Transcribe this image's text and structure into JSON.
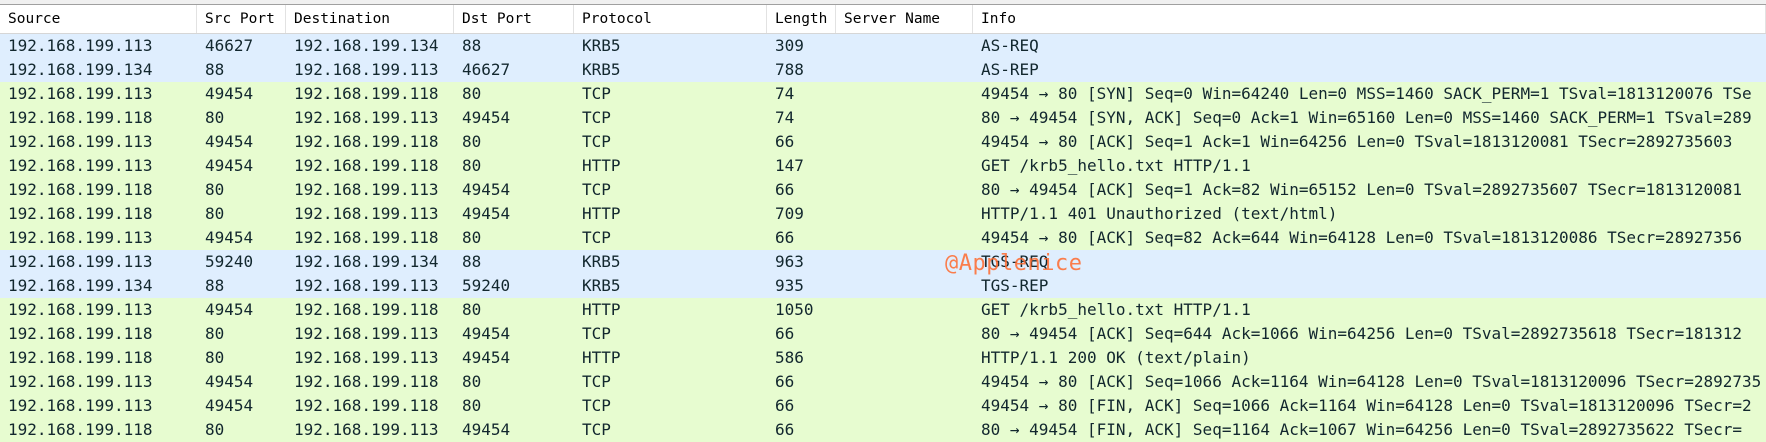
{
  "columns": {
    "source": "Source",
    "src_port": "Src Port",
    "destination": "Destination",
    "dst_port": "Dst Port",
    "protocol": "Protocol",
    "length": "Length",
    "server_name": "Server Name",
    "info": "Info"
  },
  "rows": [
    {
      "source": "192.168.199.113",
      "src_port": "46627",
      "destination": "192.168.199.134",
      "dst_port": "88",
      "protocol": "KRB5",
      "length": "309",
      "server_name": "",
      "info": "AS-REQ"
    },
    {
      "source": "192.168.199.134",
      "src_port": "88",
      "destination": "192.168.199.113",
      "dst_port": "46627",
      "protocol": "KRB5",
      "length": "788",
      "server_name": "",
      "info": "AS-REP"
    },
    {
      "source": "192.168.199.113",
      "src_port": "49454",
      "destination": "192.168.199.118",
      "dst_port": "80",
      "protocol": "TCP",
      "length": "74",
      "server_name": "",
      "info": "49454 → 80 [SYN] Seq=0 Win=64240 Len=0 MSS=1460 SACK_PERM=1 TSval=1813120076 TSe"
    },
    {
      "source": "192.168.199.118",
      "src_port": "80",
      "destination": "192.168.199.113",
      "dst_port": "49454",
      "protocol": "TCP",
      "length": "74",
      "server_name": "",
      "info": "80 → 49454 [SYN, ACK] Seq=0 Ack=1 Win=65160 Len=0 MSS=1460 SACK_PERM=1 TSval=289"
    },
    {
      "source": "192.168.199.113",
      "src_port": "49454",
      "destination": "192.168.199.118",
      "dst_port": "80",
      "protocol": "TCP",
      "length": "66",
      "server_name": "",
      "info": "49454 → 80 [ACK] Seq=1 Ack=1 Win=64256 Len=0 TSval=1813120081 TSecr=2892735603"
    },
    {
      "source": "192.168.199.113",
      "src_port": "49454",
      "destination": "192.168.199.118",
      "dst_port": "80",
      "protocol": "HTTP",
      "length": "147",
      "server_name": "",
      "info": "GET /krb5_hello.txt HTTP/1.1"
    },
    {
      "source": "192.168.199.118",
      "src_port": "80",
      "destination": "192.168.199.113",
      "dst_port": "49454",
      "protocol": "TCP",
      "length": "66",
      "server_name": "",
      "info": "80 → 49454 [ACK] Seq=1 Ack=82 Win=65152 Len=0 TSval=2892735607 TSecr=1813120081"
    },
    {
      "source": "192.168.199.118",
      "src_port": "80",
      "destination": "192.168.199.113",
      "dst_port": "49454",
      "protocol": "HTTP",
      "length": "709",
      "server_name": "",
      "info": "HTTP/1.1 401 Unauthorized  (text/html)"
    },
    {
      "source": "192.168.199.113",
      "src_port": "49454",
      "destination": "192.168.199.118",
      "dst_port": "80",
      "protocol": "TCP",
      "length": "66",
      "server_name": "",
      "info": "49454 → 80 [ACK] Seq=82 Ack=644 Win=64128 Len=0 TSval=1813120086 TSecr=28927356"
    },
    {
      "source": "192.168.199.113",
      "src_port": "59240",
      "destination": "192.168.199.134",
      "dst_port": "88",
      "protocol": "KRB5",
      "length": "963",
      "server_name": "",
      "info": "TGS-REQ"
    },
    {
      "source": "192.168.199.134",
      "src_port": "88",
      "destination": "192.168.199.113",
      "dst_port": "59240",
      "protocol": "KRB5",
      "length": "935",
      "server_name": "",
      "info": "TGS-REP"
    },
    {
      "source": "192.168.199.113",
      "src_port": "49454",
      "destination": "192.168.199.118",
      "dst_port": "80",
      "protocol": "HTTP",
      "length": "1050",
      "server_name": "",
      "info": "GET /krb5_hello.txt HTTP/1.1"
    },
    {
      "source": "192.168.199.118",
      "src_port": "80",
      "destination": "192.168.199.113",
      "dst_port": "49454",
      "protocol": "TCP",
      "length": "66",
      "server_name": "",
      "info": "80 → 49454 [ACK] Seq=644 Ack=1066 Win=64256 Len=0 TSval=2892735618 TSecr=181312"
    },
    {
      "source": "192.168.199.118",
      "src_port": "80",
      "destination": "192.168.199.113",
      "dst_port": "49454",
      "protocol": "HTTP",
      "length": "586",
      "server_name": "",
      "info": "HTTP/1.1 200 OK  (text/plain)"
    },
    {
      "source": "192.168.199.113",
      "src_port": "49454",
      "destination": "192.168.199.118",
      "dst_port": "80",
      "protocol": "TCP",
      "length": "66",
      "server_name": "",
      "info": "49454 → 80 [ACK] Seq=1066 Ack=1164 Win=64128 Len=0 TSval=1813120096 TSecr=2892735"
    },
    {
      "source": "192.168.199.113",
      "src_port": "49454",
      "destination": "192.168.199.118",
      "dst_port": "80",
      "protocol": "TCP",
      "length": "66",
      "server_name": "",
      "info": "49454 → 80 [FIN, ACK] Seq=1066 Ack=1164 Win=64128 Len=0 TSval=1813120096 TSecr=2"
    },
    {
      "source": "192.168.199.118",
      "src_port": "80",
      "destination": "192.168.199.113",
      "dst_port": "49454",
      "protocol": "TCP",
      "length": "66",
      "server_name": "",
      "info": "80 → 49454 [FIN, ACK] Seq=1164 Ack=1067 Win=64256 Len=0 TSval=2892735622 TSecr="
    }
  ],
  "watermark": "@Applenice",
  "colors": {
    "krb5_row_bg": "#dfeefe",
    "tcp_http_row_bg": "#e7fcd0",
    "watermark": "#ff6a2e"
  }
}
